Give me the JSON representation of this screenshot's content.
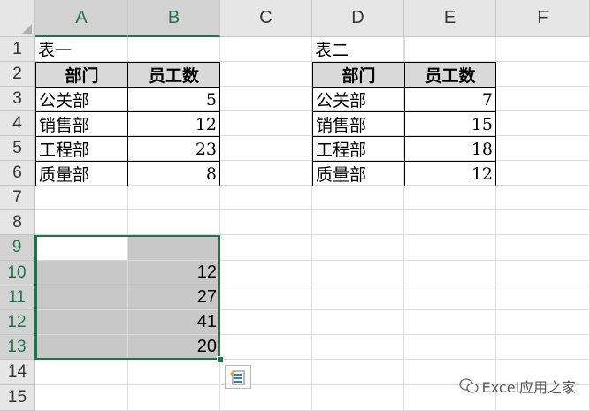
{
  "columns": [
    "A",
    "B",
    "C",
    "D",
    "E",
    "F"
  ],
  "rows": [
    "1",
    "2",
    "3",
    "4",
    "5",
    "6",
    "7",
    "8",
    "9",
    "10",
    "11",
    "12",
    "13",
    "14",
    "15"
  ],
  "table1": {
    "title": "表一",
    "headers": [
      "部门",
      "员工数"
    ],
    "rows": [
      [
        "公关部",
        "5"
      ],
      [
        "销售部",
        "12"
      ],
      [
        "工程部",
        "23"
      ],
      [
        "质量部",
        "8"
      ]
    ]
  },
  "table2": {
    "title": "表二",
    "headers": [
      "部门",
      "员工数"
    ],
    "rows": [
      [
        "公关部",
        "7"
      ],
      [
        "销售部",
        "15"
      ],
      [
        "工程部",
        "18"
      ],
      [
        "质量部",
        "12"
      ]
    ]
  },
  "selection": {
    "values": [
      "12",
      "27",
      "41",
      "20"
    ]
  },
  "watermark": "Excel应用之家",
  "colors": {
    "accent": "#217346",
    "header_fill": "#d9d9d9",
    "selection_fill": "#c8c8c8"
  }
}
